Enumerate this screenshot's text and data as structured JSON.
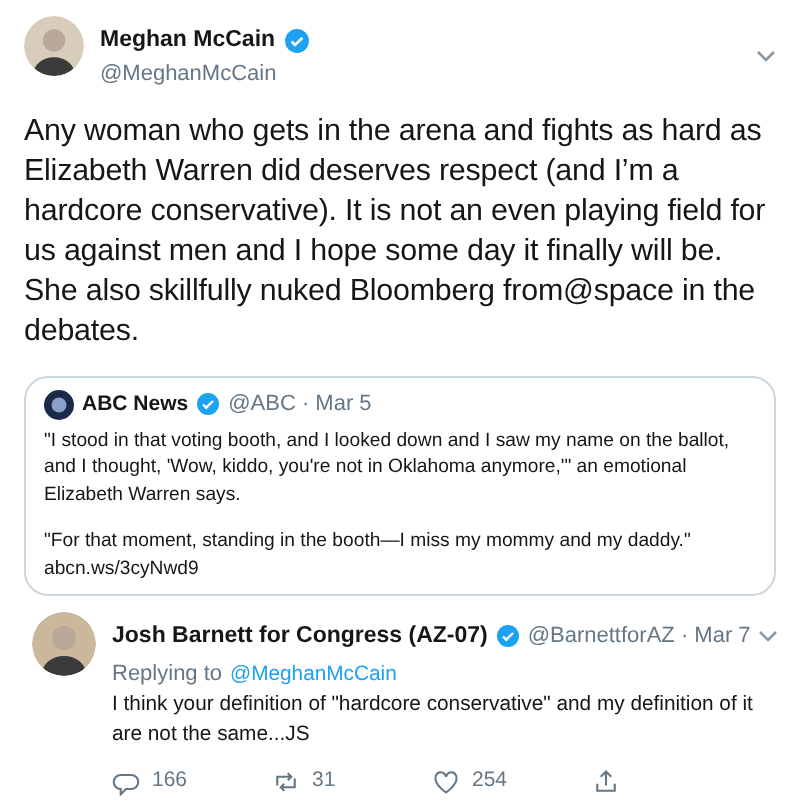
{
  "tweet": {
    "author": {
      "name": "Meghan McCain",
      "handle": "@MeghanMcCain",
      "verified": true
    },
    "text": "Any woman who gets in the arena and fights as hard as Elizabeth Warren did deserves respect (and I’m a hardcore conservative). It is not an even playing field for us against men and I hope some day it finally will be. She also skillfully nuked Bloomberg from@space in the debates.",
    "quoted": {
      "author": {
        "name": "ABC News",
        "meta": "@ABC · Mar 5",
        "verified": true
      },
      "paragraphs": [
        "\"I stood in that voting booth, and I looked down and I saw my name on the ballot, and I thought, 'Wow, kiddo, you're not in Oklahoma anymore,'\" an emotional Elizabeth Warren says.",
        "\"For that moment, standing in the booth—I miss my mommy and my daddy.\""
      ],
      "link": "abcn.ws/3cyNwd9"
    }
  },
  "reply": {
    "author": {
      "name": "Josh Barnett for Congress (AZ-07)",
      "meta": "@BarnettforAZ · Mar 7",
      "verified": true
    },
    "replying_label": "Replying to",
    "replying_handle": "@MeghanMcCain",
    "text": "I think your definition of \"hardcore conservative\" and my definition of it are not the same...JS",
    "actions": [
      {
        "kind": "reply",
        "count": "166"
      },
      {
        "kind": "retweet",
        "count": "31"
      },
      {
        "kind": "like",
        "count": "254"
      },
      {
        "kind": "share"
      }
    ]
  }
}
